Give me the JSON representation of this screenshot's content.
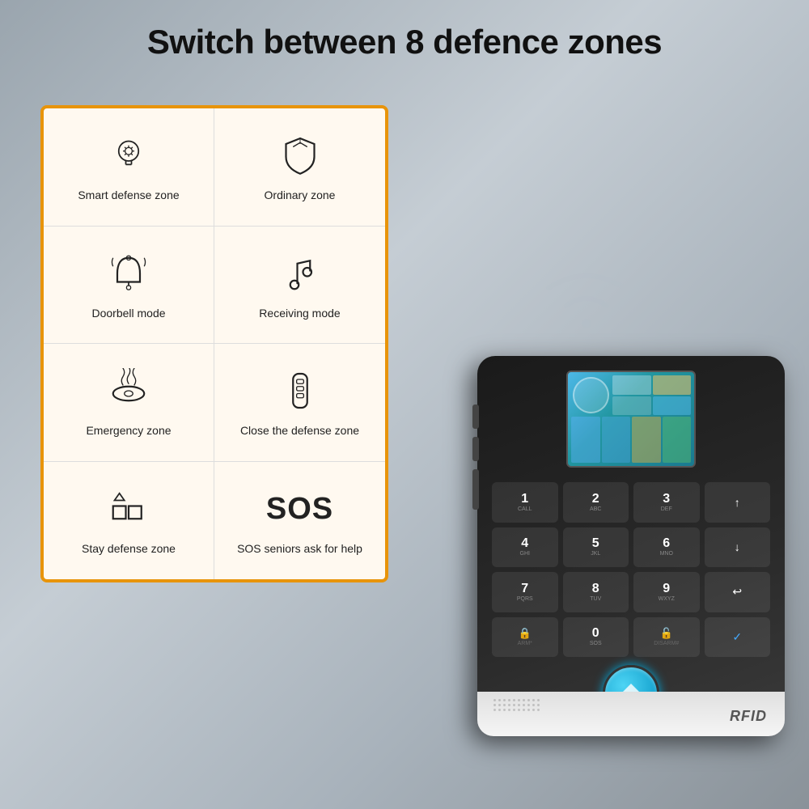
{
  "title": "Switch between 8 defence zones",
  "zones": [
    {
      "id": "smart-defense",
      "label": "Smart defense zone",
      "icon": "brain-gear"
    },
    {
      "id": "ordinary",
      "label": "Ordinary zone",
      "icon": "shield"
    },
    {
      "id": "doorbell",
      "label": "Doorbell mode",
      "icon": "bell"
    },
    {
      "id": "receiving",
      "label": "Receiving mode",
      "icon": "music-note"
    },
    {
      "id": "emergency",
      "label": "Emergency zone",
      "icon": "smoke-detector"
    },
    {
      "id": "close-defense",
      "label": "Close the defense zone",
      "icon": "key-fob"
    },
    {
      "id": "stay-defense",
      "label": "Stay defense zone",
      "icon": "shapes"
    },
    {
      "id": "sos",
      "label": "SOS seniors ask for help",
      "icon": "sos"
    }
  ],
  "device": {
    "rfid_label": "RFID",
    "keypad": [
      {
        "num": "1",
        "letters": "CALL"
      },
      {
        "num": "2",
        "letters": "ABC"
      },
      {
        "num": "3",
        "letters": "DEF"
      },
      {
        "num": "↑",
        "letters": ""
      },
      {
        "num": "4",
        "letters": "GHI"
      },
      {
        "num": "5",
        "letters": "JKL"
      },
      {
        "num": "6",
        "letters": "MNO"
      },
      {
        "num": "↓",
        "letters": ""
      },
      {
        "num": "7",
        "letters": "PQRS"
      },
      {
        "num": "8",
        "letters": "TUV"
      },
      {
        "num": "9",
        "letters": "WXYZ"
      },
      {
        "num": "↩",
        "letters": ""
      },
      {
        "num": "🔒",
        "letters": "ARM*"
      },
      {
        "num": "0",
        "letters": "SOS"
      },
      {
        "num": "🔓",
        "letters": "DISARM#"
      },
      {
        "num": "✓",
        "letters": ""
      }
    ]
  }
}
